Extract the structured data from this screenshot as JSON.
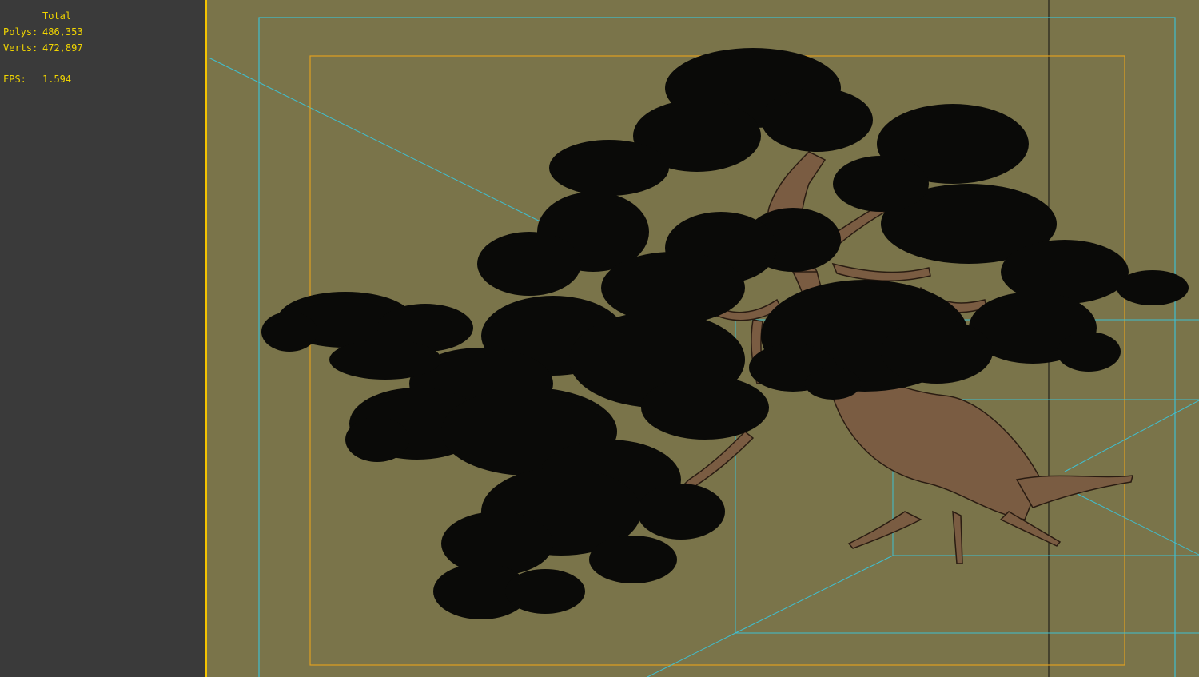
{
  "stats": {
    "header": "Total",
    "polys_label": "Polys:",
    "polys_value": "486,353",
    "verts_label": "Verts:",
    "verts_value": "472,897",
    "fps_label": "FPS:",
    "fps_value": "1.594"
  },
  "colors": {
    "panel_bg": "#3a3a3a",
    "viewport_bg": "#7a744a",
    "stats_text": "#f2d600",
    "safe_frame_outer": "#3fbfd0",
    "safe_frame_inner": "#e0a020",
    "foliage": "#0a0a08",
    "bark": "#7a5c42"
  },
  "icons": [
    "bonsai-tree-model"
  ]
}
